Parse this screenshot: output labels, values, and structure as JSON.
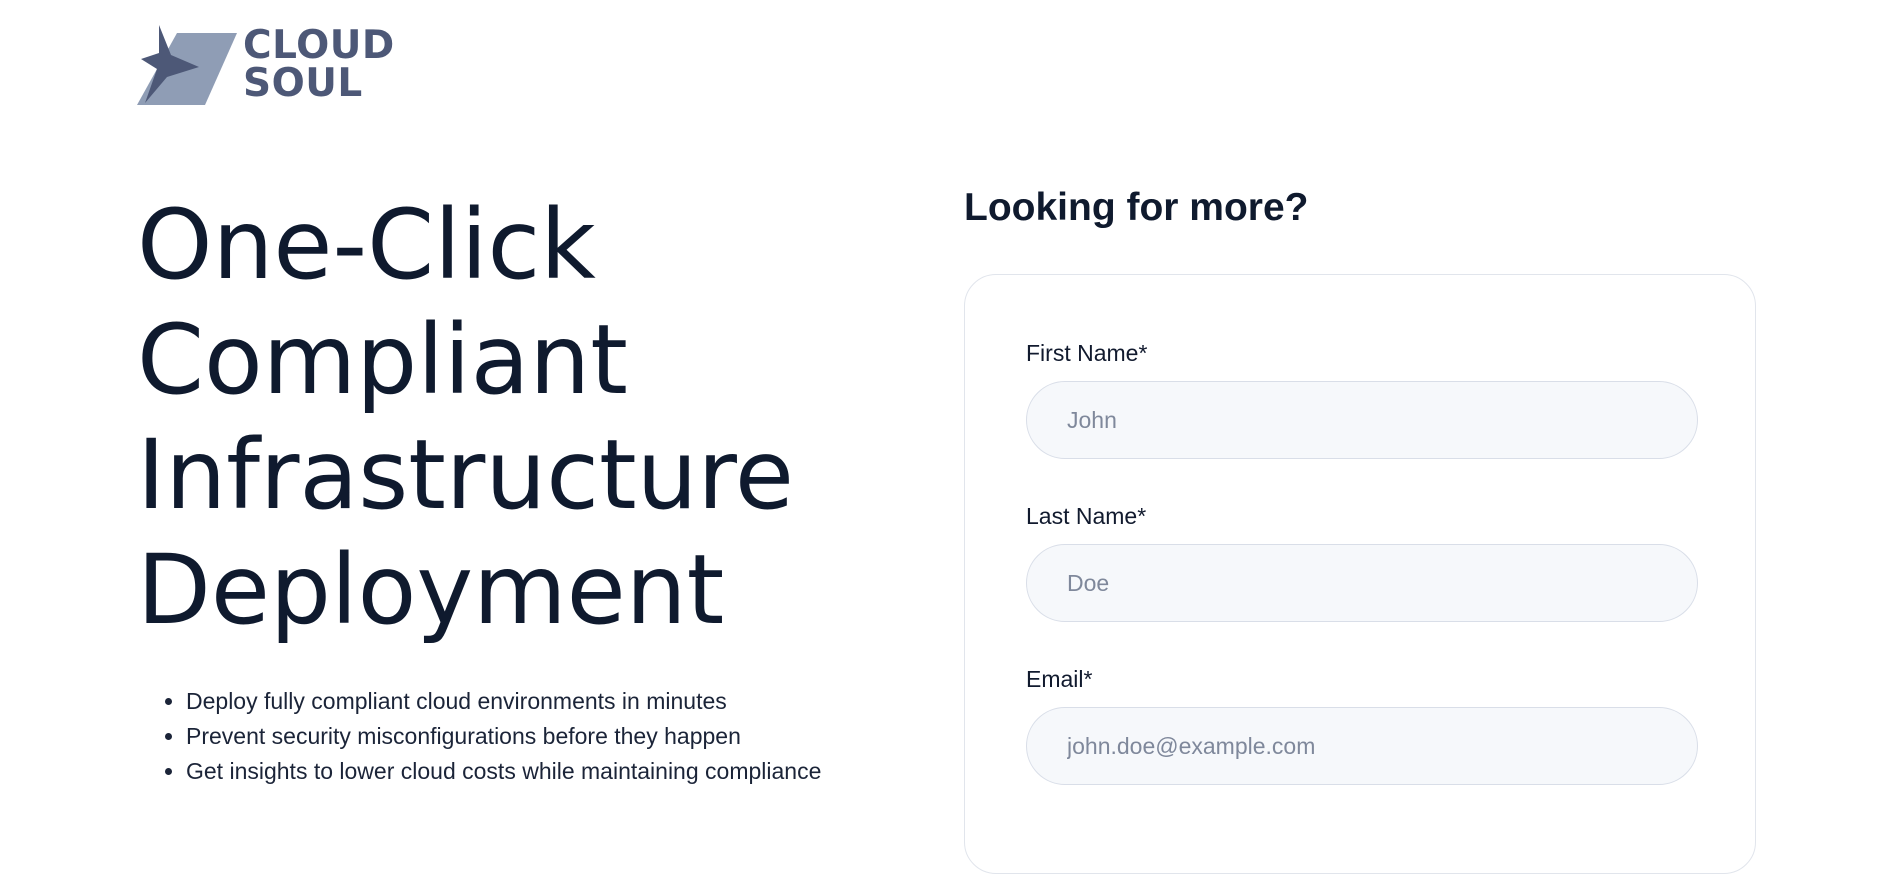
{
  "brand": {
    "line1": "CLOUD",
    "line2": "SOUL",
    "color": "#4d5877"
  },
  "hero": {
    "title_lines": [
      "One-Click",
      "Compliant",
      "Infrastructure",
      "Deployment"
    ],
    "bullets": [
      "Deploy fully compliant cloud environments in minutes",
      "Prevent security misconfigurations before they happen",
      "Get insights to lower cloud costs while maintaining compliance"
    ]
  },
  "form": {
    "heading": "Looking for more?",
    "fields": {
      "first_name": {
        "label": "First Name*",
        "placeholder": "John",
        "value": ""
      },
      "last_name": {
        "label": "Last Name*",
        "placeholder": "Doe",
        "value": ""
      },
      "email": {
        "label": "Email*",
        "placeholder": "john.doe@example.com",
        "value": ""
      }
    }
  },
  "colors": {
    "text": "#0f1a2e",
    "input_bg": "#f6f8fb",
    "input_border": "#d9dee8",
    "card_border": "#e1e5ec",
    "placeholder": "#7f889b"
  }
}
